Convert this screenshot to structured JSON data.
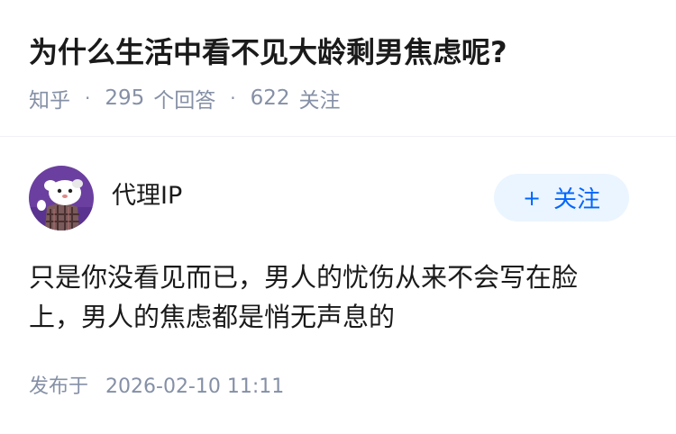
{
  "question": {
    "title": "为什么生活中看不见大龄剩男焦虑呢?",
    "source": "知乎",
    "answer_count": "295",
    "answer_label": "个回答",
    "follow_count": "622",
    "follow_label": "关注",
    "separator": "·"
  },
  "answer": {
    "author_name": "代理IP",
    "follow_button_plus": "+",
    "follow_button_label": "关注",
    "content": "只是你没看见而已，男人的忧伤从来不会写在脸上，男人的焦虑都是悄无声息的",
    "publish_label": "发布于",
    "publish_time": "2026-02-10 11:11"
  },
  "colors": {
    "title": "#1a1a1a",
    "meta": "#8590a6",
    "follow_button_bg": "#ebf5ff",
    "follow_button_text": "#0066ff",
    "avatar_bg": "#6b3fa0"
  },
  "icons": {
    "avatar": "cartoon-animal-avatar",
    "plus": "plus-icon"
  }
}
